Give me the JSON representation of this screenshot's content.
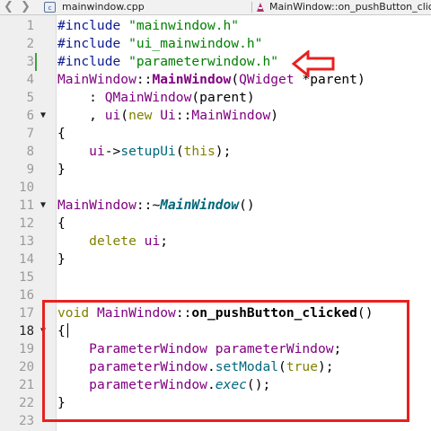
{
  "tabs": {
    "back_icon": "arrow-left",
    "forward_icon": "arrow-right",
    "file_icon": "cpp-file",
    "file_name": "mainwindow.cpp",
    "function_icon": "function",
    "function_name": "MainWindow::on_pushButton_clicked"
  },
  "editor": {
    "line_numbers": [
      "1",
      "2",
      "3",
      "4",
      "5",
      "6",
      "7",
      "8",
      "9",
      "10",
      "11",
      "12",
      "13",
      "14",
      "15",
      "16",
      "17",
      "18",
      "19",
      "20",
      "21",
      "22",
      "23"
    ],
    "current_line": "18",
    "code": {
      "l1_a": "#include ",
      "l1_b": "\"mainwindow.h\"",
      "l2_a": "#include ",
      "l2_b": "\"ui_mainwindow.h\"",
      "l3_a": "#include ",
      "l3_b": "\"parameterwindow.h\"",
      "l4_a": "MainWindow",
      "l4_b": "::",
      "l4_c": "MainWindow",
      "l4_d": "(",
      "l4_e": "QWidget",
      "l4_f": " *",
      "l4_g": "parent",
      "l4_h": ")",
      "l5_a": "    : ",
      "l5_b": "QMainWindow",
      "l5_c": "(",
      "l5_d": "parent",
      "l5_e": ")",
      "l6_a": "    , ",
      "l6_b": "ui",
      "l6_c": "(",
      "l6_d": "new",
      "l6_e": " ",
      "l6_f": "Ui",
      "l6_g": "::",
      "l6_h": "MainWindow",
      "l6_i": ")",
      "l7": "{",
      "l8_a": "    ",
      "l8_b": "ui",
      "l8_c": "->",
      "l8_d": "setupUi",
      "l8_e": "(",
      "l8_f": "this",
      "l8_g": ");",
      "l9": "}",
      "l11_a": "MainWindow",
      "l11_b": "::~",
      "l11_c": "MainWindow",
      "l11_d": "()",
      "l12": "{",
      "l13_a": "    ",
      "l13_b": "delete",
      "l13_c": " ",
      "l13_d": "ui",
      "l13_e": ";",
      "l14": "}",
      "l17_a": "void",
      "l17_b": " ",
      "l17_c": "MainWindow",
      "l17_d": "::",
      "l17_e": "on_pushButton_clicked",
      "l17_f": "()",
      "l18": "{",
      "l19_a": "    ",
      "l19_b": "ParameterWindow",
      "l19_c": " ",
      "l19_d": "parameterWindow",
      "l19_e": ";",
      "l20_a": "    ",
      "l20_b": "parameterWindow",
      "l20_c": ".",
      "l20_d": "setModal",
      "l20_e": "(",
      "l20_f": "true",
      "l20_g": ");",
      "l21_a": "    ",
      "l21_b": "parameterWindow",
      "l21_c": ".",
      "l21_d": "exec",
      "l21_e": "();",
      "l22": "}"
    }
  },
  "annotations": {
    "color": "#e8201f",
    "arrow_icon": "arrow-left-outline",
    "highlighted_function": "on_pushButton_clicked"
  },
  "colors": {
    "preprocessor": "#0b1a8e",
    "string": "#008000",
    "type": "#800080",
    "keyword": "#808000",
    "function": "#00677c",
    "gutter": "#efefef"
  }
}
